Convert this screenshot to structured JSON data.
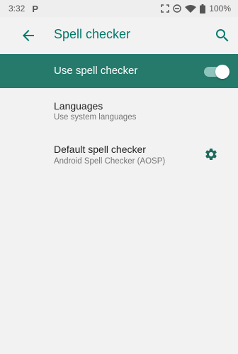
{
  "status_bar": {
    "time": "3:32",
    "notification_letter": "P",
    "battery_text": "100%",
    "icons": [
      "screenshot-icon",
      "do-not-disturb-icon",
      "wifi-icon",
      "battery-icon"
    ]
  },
  "app_bar": {
    "title": "Spell checker",
    "icons": [
      "back-arrow-icon",
      "search-icon"
    ],
    "accent_color": "#00796b"
  },
  "master_switch": {
    "label": "Use spell checker",
    "state": "on",
    "background_color": "#267a6b"
  },
  "preferences": [
    {
      "title": "Languages",
      "summary": "Use system languages"
    },
    {
      "title": "Default spell checker",
      "summary": "Android Spell Checker (AOSP)",
      "icon": "gear-icon"
    }
  ]
}
